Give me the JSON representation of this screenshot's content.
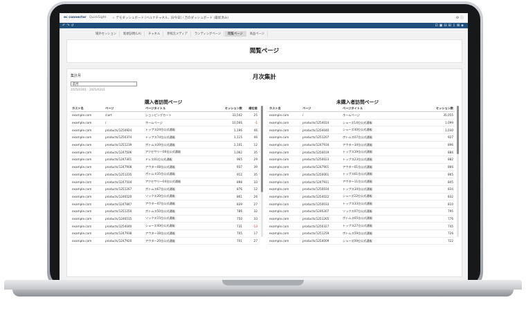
{
  "topbar": {
    "logo": "ec connector",
    "product": "QuickSight",
    "breadcrumb": "☆ デモダッシュボード [ベルナチャネル、旧今日] / 万のダッシュボード (最新済み)"
  },
  "tabs": [
    "場外セッション",
    "新規訪問(LA)",
    "チャネル",
    "参照元メディア",
    "ランディングページ",
    "閲覧ページ",
    "商品ページ"
  ],
  "active_tab": "閲覧ページ",
  "section1_title": "閲覧ページ",
  "section2_title": "月次集計",
  "control": {
    "label": "集計月",
    "value": "前月",
    "range": "2025/03/01 - 2025/03/31"
  },
  "buyers": {
    "title": "購入者訪問ページ",
    "headers": [
      "ホスト名",
      "ページ",
      "ページタイトル",
      "セッション数",
      "順位差"
    ],
    "rows": [
      [
        "example.com",
        "/cart",
        "ショッピングカート",
        "33,542",
        "25"
      ],
      [
        "example.com",
        "/",
        "ホームページ",
        "10,566",
        "-1"
      ],
      [
        "example.com",
        "products/1250924",
        "トップス24位公式通販",
        "1,196",
        "46"
      ],
      [
        "example.com",
        "products/1250374",
        "トップス74位公式通販",
        "1,115",
        "46"
      ],
      [
        "example.com",
        "products/1251239",
        "ボトムス39位公式通販",
        "1,101",
        "12"
      ],
      [
        "example.com",
        "products/1247506",
        "アクセサリー06位公式通販",
        "1,062",
        "35"
      ],
      [
        "example.com",
        "products/1247301",
        "ドレス01位公式通販",
        "965",
        "29"
      ],
      [
        "example.com",
        "products/1247908",
        "アウター08位公式通販",
        "937",
        "39"
      ],
      [
        "example.com",
        "products/1251235",
        "ボトムス35位公式通販",
        "912",
        "35"
      ],
      [
        "example.com",
        "products/1247504",
        "アクセサリー04位公式通販",
        "898",
        "33"
      ],
      [
        "example.com",
        "products/1251267",
        "ボトムス67位公式通販",
        "876",
        "12"
      ],
      [
        "example.com",
        "products/1246520",
        "ソックス20位公式通販",
        "861",
        "26"
      ],
      [
        "example.com",
        "products/1247847",
        "アウター47位公式通販",
        "839",
        "27"
      ],
      [
        "example.com",
        "products/1251250",
        "ボトムス50位公式通販",
        "786",
        "32"
      ],
      [
        "example.com",
        "products/1246515",
        "ソックス15位公式通販",
        "750",
        "33"
      ],
      [
        "example.com",
        "products/1254040",
        "シューズ40位公式通販",
        "731",
        "-13"
      ],
      [
        "example.com",
        "products/1247938",
        "アウター38位公式通販",
        "705",
        "17"
      ],
      [
        "example.com",
        "products/1247920",
        "アウター20位公式通販",
        "701",
        "27"
      ]
    ]
  },
  "non_buyers": {
    "title": "未購入者訪問ページ",
    "headers": [
      "ホスト名",
      "ページ",
      "ページタイトル",
      "セッション数"
    ],
    "rows": [
      [
        "example.com",
        "/",
        "ホームページ",
        "35,055"
      ],
      [
        "example.com",
        "products/1254014",
        "シューズ14位公式通販",
        "1,099"
      ],
      [
        "example.com",
        "products/1254040",
        "シューズ40位公式通販",
        "1,030"
      ],
      [
        "example.com",
        "products/1251207",
        "ボトムス07位公式通販",
        "927"
      ],
      [
        "example.com",
        "products/1247934",
        "アウター34位公式通販",
        "896"
      ],
      [
        "example.com",
        "products/1250019",
        "トップス19位公式通販",
        "886"
      ],
      [
        "example.com",
        "products/1250023",
        "トップス23位公式通販",
        "882"
      ],
      [
        "example.com",
        "products/1247901",
        "アウター01位公式通販",
        "866"
      ],
      [
        "example.com",
        "products/1250061",
        "トップス61位公式通販",
        "865"
      ],
      [
        "example.com",
        "products/1247911",
        "アウター11位公式通販",
        "845"
      ],
      [
        "example.com",
        "products/1250034",
        "トップス34位公式通販",
        "834"
      ],
      [
        "example.com",
        "products/1254022",
        "シューズ22位公式通販",
        "832"
      ],
      [
        "example.com",
        "products/1250033",
        "トップス33位公式通販",
        "810"
      ],
      [
        "example.com",
        "products/1246307",
        "ソックス07位公式通販",
        "795"
      ],
      [
        "example.com",
        "products/1251265",
        "ボトムス65位公式通販",
        "776"
      ],
      [
        "example.com",
        "products/1250327",
        "トップス27位公式通販",
        "745"
      ],
      [
        "example.com",
        "products/1251259",
        "ボトムス59位公式通販",
        "726"
      ],
      [
        "example.com",
        "products/1254009",
        "シューズ09位公式通販",
        "722"
      ]
    ]
  }
}
